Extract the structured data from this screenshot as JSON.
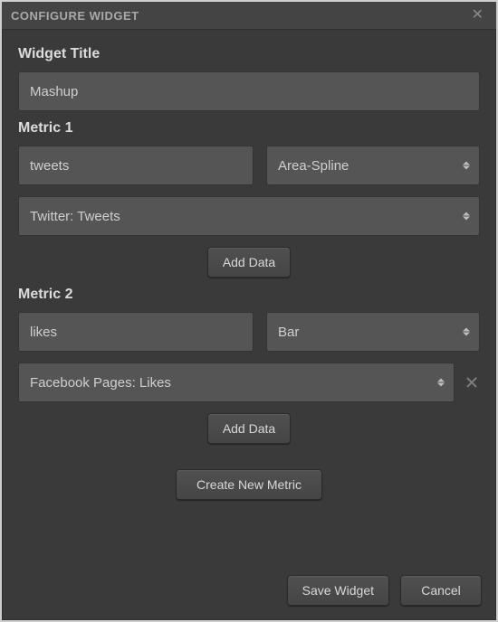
{
  "dialog": {
    "title": "CONFIGURE WIDGET"
  },
  "widgetTitle": {
    "label": "Widget Title",
    "value": "Mashup"
  },
  "metrics": [
    {
      "label": "Metric 1",
      "name": "tweets",
      "chartType": "Area-Spline",
      "dataSource": "Twitter: Tweets",
      "removable": false,
      "addDataLabel": "Add Data"
    },
    {
      "label": "Metric 2",
      "name": "likes",
      "chartType": "Bar",
      "dataSource": "Facebook Pages: Likes",
      "removable": true,
      "addDataLabel": "Add Data"
    }
  ],
  "actions": {
    "createMetric": "Create New Metric",
    "save": "Save Widget",
    "cancel": "Cancel"
  }
}
